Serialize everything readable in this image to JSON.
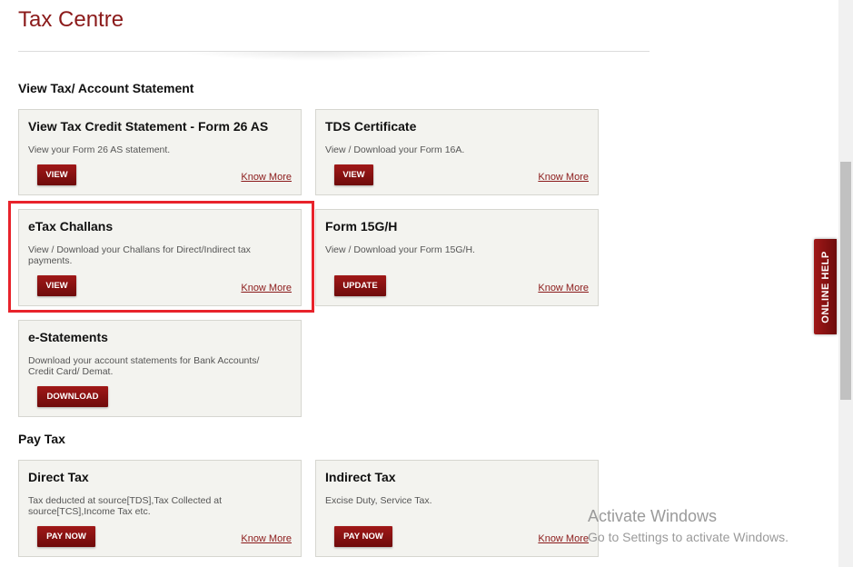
{
  "page": {
    "title": "Tax Centre"
  },
  "sections": {
    "view": "View Tax/ Account Statement",
    "pay": "Pay Tax"
  },
  "cards": {
    "form26as": {
      "title": "View Tax Credit Statement - Form 26 AS",
      "desc": "View your Form 26 AS statement.",
      "button": "VIEW",
      "link": "Know More"
    },
    "tds": {
      "title": "TDS Certificate",
      "desc": "View / Download your Form 16A.",
      "button": "VIEW",
      "link": "Know More"
    },
    "etax": {
      "title": "eTax Challans",
      "desc": "View / Download your Challans for Direct/Indirect tax payments.",
      "button": "VIEW",
      "link": "Know More"
    },
    "form15": {
      "title": "Form 15G/H",
      "desc": "View / Download your Form 15G/H.",
      "button": "UPDATE",
      "link": "Know More"
    },
    "estatements": {
      "title": "e-Statements",
      "desc": "Download your account statements for Bank Accounts/ Credit Card/ Demat.",
      "button": "DOWNLOAD"
    },
    "direct": {
      "title": "Direct Tax",
      "desc": "Tax deducted at source[TDS],Tax Collected at source[TCS],Income Tax etc.",
      "button": "PAY NOW",
      "link": "Know More"
    },
    "indirect": {
      "title": "Indirect Tax",
      "desc": "Excise Duty, Service Tax.",
      "button": "PAY NOW",
      "link": "Know More"
    }
  },
  "online_help": "ONLINE HELP",
  "watermark": {
    "line1": "Activate Windows",
    "line2": "Go to Settings to activate Windows."
  }
}
